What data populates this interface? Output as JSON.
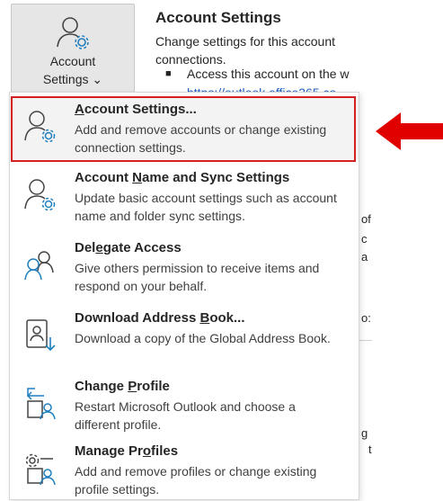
{
  "ribbon": {
    "account_button_line1": "Account",
    "account_button_line2": "Settings",
    "account_button_chevron": "⌄",
    "icon": "account-settings-icon"
  },
  "info": {
    "title": "Account Settings",
    "description_line1": "Change settings for this account",
    "description_line2": "connections.",
    "bullet": "■",
    "bullet_text": "Access this account on the w",
    "link_text": "https://outlook.office365.co",
    "fragments": [
      "of",
      "c",
      "a",
      "o:",
      "g",
      "t"
    ]
  },
  "menu": {
    "items": [
      {
        "title_pre": "",
        "title_u": "A",
        "title_post": "ccount Settings...",
        "desc": "Add and remove accounts or change existing connection settings.",
        "icon": "account-settings-icon",
        "selected": true
      },
      {
        "title_pre": "Account ",
        "title_u": "N",
        "title_post": "ame and Sync Settings",
        "desc": "Update basic account settings such as account name and folder sync settings.",
        "icon": "account-settings-icon"
      },
      {
        "title_pre": "Del",
        "title_u": "e",
        "title_post": "gate Access",
        "desc": "Give others permission to receive items and respond on your behalf.",
        "icon": "delegate-people-icon"
      },
      {
        "title_pre": "Download Address ",
        "title_u": "B",
        "title_post": "ook...",
        "desc": "Download a copy of the Global Address Book.",
        "icon": "address-book-download-icon"
      },
      {
        "title_pre": "Change ",
        "title_u": "P",
        "title_post": "rofile",
        "desc": "Restart Microsoft Outlook and choose a different profile.",
        "icon": "change-profile-icon"
      },
      {
        "title_pre": "Manage Pr",
        "title_u": "o",
        "title_post": "files",
        "desc": "Add and remove profiles or change existing profile settings.",
        "icon": "manage-profiles-icon"
      }
    ]
  },
  "annotation": {
    "arrow_color": "#e00000",
    "highlight_color": "#d42020"
  }
}
